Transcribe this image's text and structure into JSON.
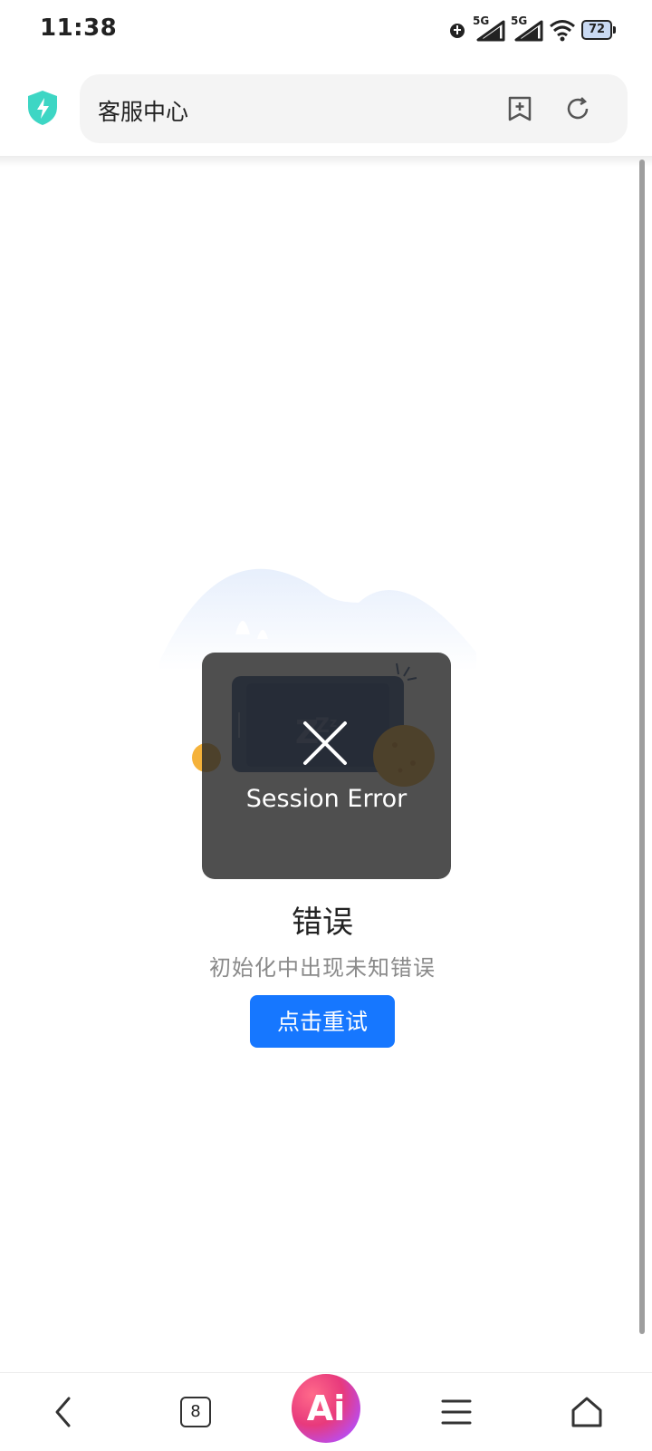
{
  "status_bar": {
    "time": "11:38",
    "network_1": "5G",
    "network_2": "5G",
    "battery": "72"
  },
  "browser": {
    "url_title": "客服中心",
    "security_icon": "shield-bolt-icon",
    "accent_color": "#3dd6c4"
  },
  "page": {
    "toast_text": "Session Error",
    "error_title": "错误",
    "error_description": "初始化中出现未知错误",
    "retry_label": "点击重试",
    "retry_color": "#1677ff"
  },
  "bottom_nav": {
    "tab_count": "8",
    "ai_label": "Ai"
  }
}
